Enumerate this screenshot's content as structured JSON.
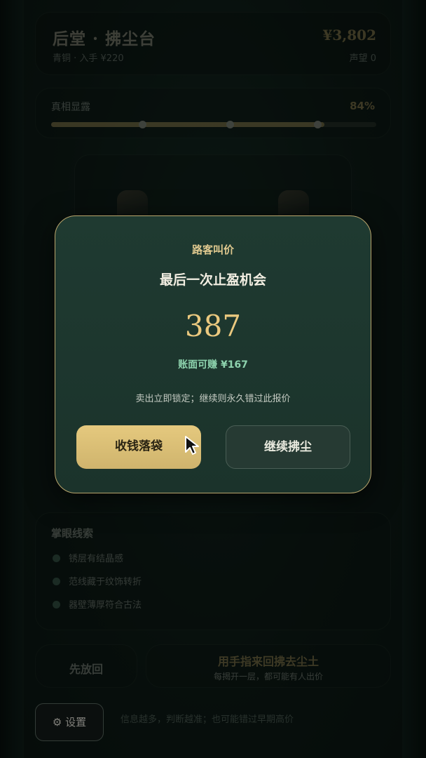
{
  "header": {
    "title": "后堂 · 拂尘台",
    "subtitle": "青铜 · 入手 ¥220",
    "money": "¥3,802",
    "reputation": "声望 0"
  },
  "progress": {
    "label": "真相显露",
    "percent_label": "84%",
    "value": 0.84,
    "milestones": [
      0.28,
      0.55,
      0.82
    ]
  },
  "clues": {
    "title": "掌眼线索",
    "items": [
      "锈层有结晶感",
      "范线藏于纹饰转折",
      "器壁薄厚符合古法"
    ]
  },
  "actions": {
    "put_back": "先放回",
    "brush_main": "用手指来回拂去尘土",
    "brush_sub": "每揭开一层，都可能有人出价",
    "settings": "⚙ 设置",
    "hint": "信息越多，判断越准；也可能错过早期高价"
  },
  "modal": {
    "kicker": "路客叫价",
    "title": "最后一次止盈机会",
    "offer": "387",
    "profit": "账面可赚 ¥167",
    "note": "卖出立即锁定；继续则永久错过此报价",
    "sell_label": "收钱落袋",
    "continue_label": "继续拂尘"
  },
  "colors": {
    "gold": "#e5c47a",
    "profit_green": "#8dd2ad",
    "modal_border": "#b9a56c"
  }
}
